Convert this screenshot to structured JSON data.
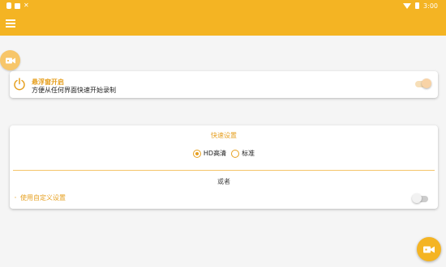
{
  "status_bar": {
    "time": "3:00",
    "icons": [
      "notification-icon",
      "image-icon",
      "close-icon",
      "wifi-icon",
      "battery-icon"
    ]
  },
  "app_bar": {
    "menu_icon": "menu-icon",
    "color": "#f4b423"
  },
  "floating_window_card": {
    "icon": "power-icon",
    "title": "悬浮窗开启",
    "subtitle": "方便从任何界面快速开始录制",
    "toggle_on": true
  },
  "quick_settings_card": {
    "title": "快速设置",
    "options": [
      {
        "label": "HD高清",
        "checked": true
      },
      {
        "label": "标准",
        "checked": false
      }
    ],
    "or_text": "或者",
    "custom_label": "使用自定义设置",
    "custom_toggle_on": false
  },
  "fab": {
    "icon": "video-camera-icon"
  },
  "colors": {
    "accent": "#f4b423",
    "accent_text": "#e6a020",
    "background": "#f5f5f5"
  }
}
